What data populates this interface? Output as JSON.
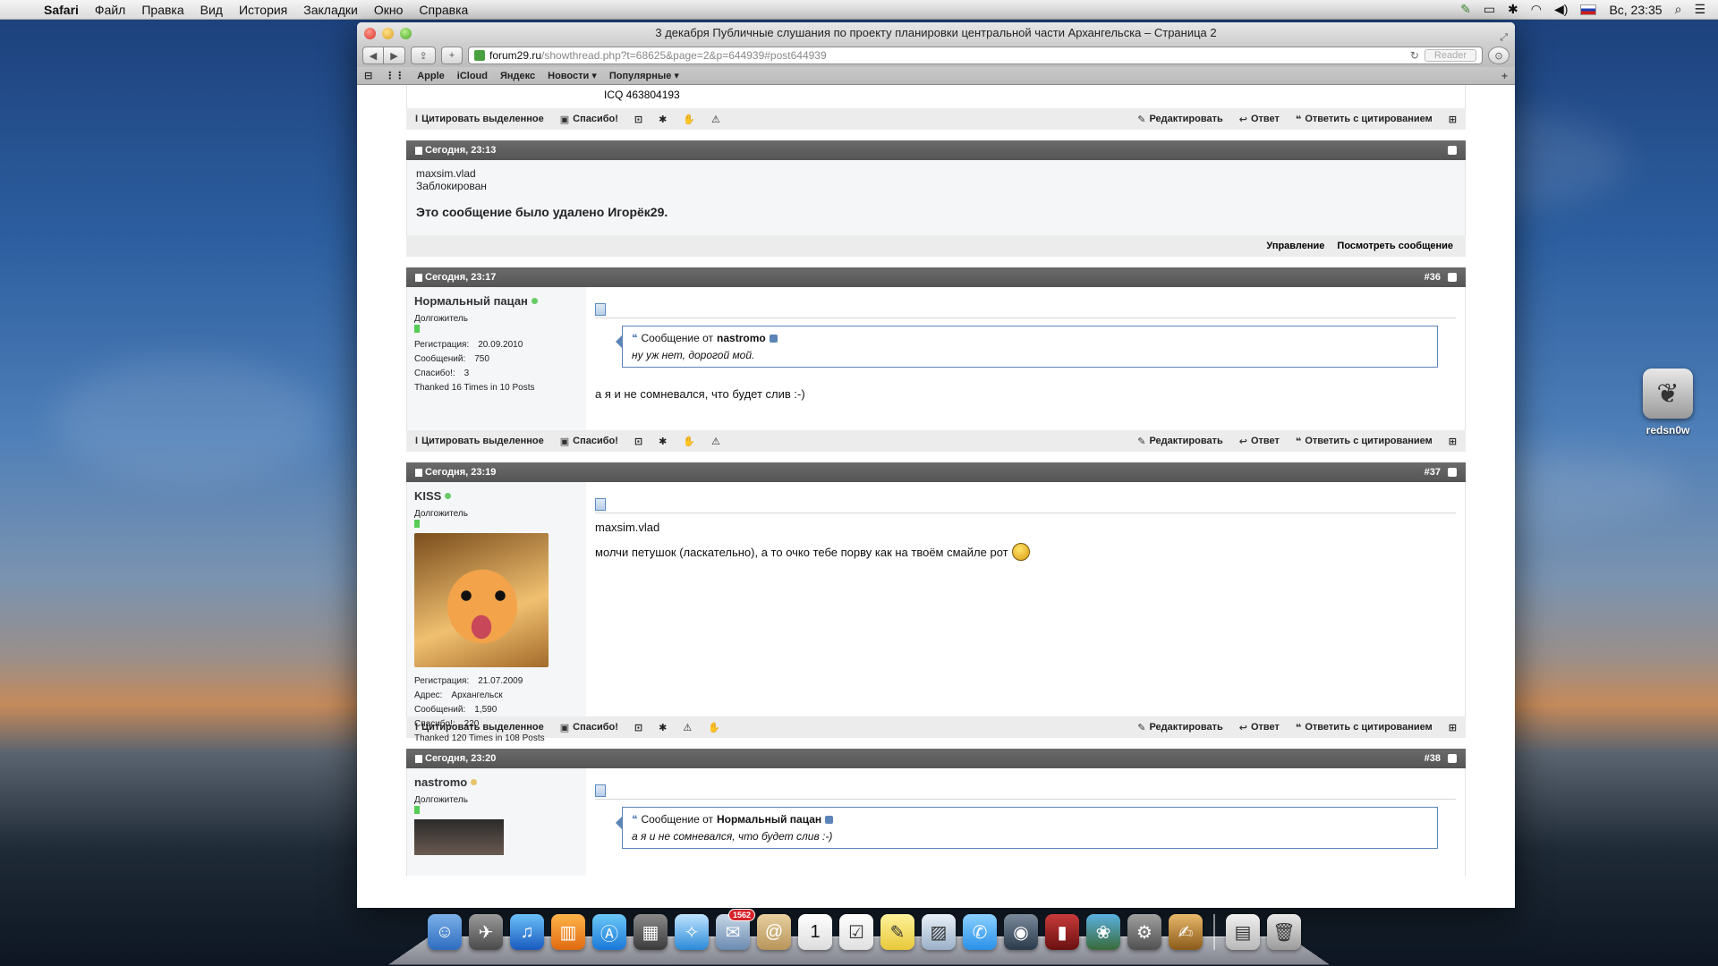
{
  "menubar": {
    "app": "Safari",
    "items": [
      "Файл",
      "Правка",
      "Вид",
      "История",
      "Закладки",
      "Окно",
      "Справка"
    ],
    "clock": "Вс, 23:35"
  },
  "window": {
    "title": "3 декабря Публичные слушания по проекту планировки центральной части Архангельска – Страница 2"
  },
  "toolbar": {
    "url_domain": "forum29.ru",
    "url_path": "/showthread.php?t=68625&page=2&p=644939#post644939",
    "reader_label": "Reader"
  },
  "bookmarks": [
    "Apple",
    "iCloud",
    "Яндекс",
    "Новости ▾",
    "Популярные ▾"
  ],
  "actions": {
    "quote_selected": "Цитировать выделенное",
    "thanks": "Спасибо!",
    "edit": "Редактировать",
    "reply": "Ответ",
    "reply_quote": "Ответить с цитированием"
  },
  "top_fragment": {
    "icq": "ICQ 463804193"
  },
  "deleted_post": {
    "time": "Сегодня, 23:13",
    "user": "maxsim.vlad",
    "status": "Заблокирован",
    "message": "Это сообщение было удалено Игорёк29.",
    "manage": "Управление",
    "view": "Посмотреть сообщение"
  },
  "posts": [
    {
      "time": "Сегодня, 23:17",
      "num": "#36",
      "user": "Нормальный пацан",
      "rank": "Долгожитель",
      "stats": [
        {
          "k": "Регистрация:",
          "v": "20.09.2010"
        },
        {
          "k": "Сообщений:",
          "v": "750"
        },
        {
          "k": "Спасибо!:",
          "v": "3"
        }
      ],
      "thanked": "Thanked 16 Times in 10 Posts",
      "quote_from_label": "Сообщение от",
      "quote_author": "nastromo",
      "quote_text": "ну уж нет, дорогой мой.",
      "text": "а я и не сомневался, что будет слив :-)"
    },
    {
      "time": "Сегодня, 23:19",
      "num": "#37",
      "user": "KISS",
      "rank": "Долгожитель",
      "stats": [
        {
          "k": "Регистрация:",
          "v": "21.07.2009"
        },
        {
          "k": "Адрес:",
          "v": "Архангельск"
        },
        {
          "k": "Сообщений:",
          "v": "1,590"
        },
        {
          "k": "Спасибо!:",
          "v": "220"
        }
      ],
      "thanked": "Thanked 120 Times in 108 Posts",
      "line1": "maxsim.vlad",
      "text": "молчи петушок (ласкательно), а то очко тебе порву как на твоём смайле рот"
    },
    {
      "time": "Сегодня, 23:20",
      "num": "#38",
      "user": "nastromo",
      "rank": "Долгожитель",
      "quote_from_label": "Сообщение от",
      "quote_author": "Нормальный пацан",
      "quote_text": "а я и не сомневался, что будет слив :-)"
    }
  ],
  "desktop": {
    "icon_label": "redsn0w"
  },
  "dock": {
    "mail_badge": "1562",
    "calendar_day": "1"
  }
}
